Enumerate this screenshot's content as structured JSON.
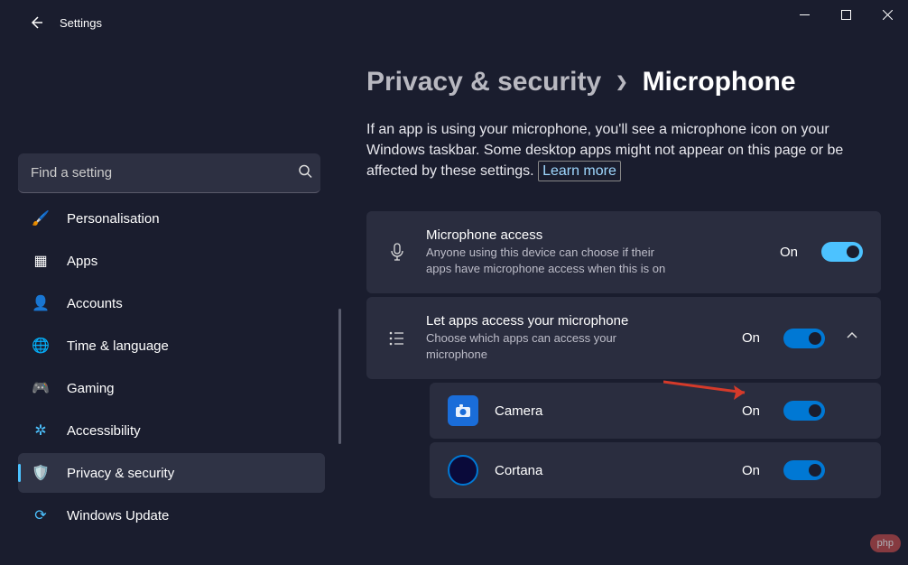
{
  "app": {
    "title": "Settings"
  },
  "search": {
    "placeholder": "Find a setting"
  },
  "nav": {
    "personalisation": "Personalisation",
    "apps": "Apps",
    "accounts": "Accounts",
    "time": "Time & language",
    "gaming": "Gaming",
    "accessibility": "Accessibility",
    "privacy": "Privacy & security",
    "update": "Windows Update"
  },
  "breadcrumb": {
    "parent": "Privacy & security",
    "current": "Microphone"
  },
  "description": "If an app is using your microphone, you'll see a microphone icon on your Windows taskbar. Some desktop apps might not appear on this page or be affected by these settings.",
  "learn_more": "Learn more",
  "settings": {
    "mic_access": {
      "title": "Microphone access",
      "sub": "Anyone using this device can choose if their apps have microphone access when this is on",
      "state": "On"
    },
    "let_apps": {
      "title": "Let apps access your microphone",
      "sub": "Choose which apps can access your microphone",
      "state": "On"
    }
  },
  "apps": {
    "camera": {
      "name": "Camera",
      "state": "On"
    },
    "cortana": {
      "name": "Cortana",
      "state": "On"
    }
  }
}
